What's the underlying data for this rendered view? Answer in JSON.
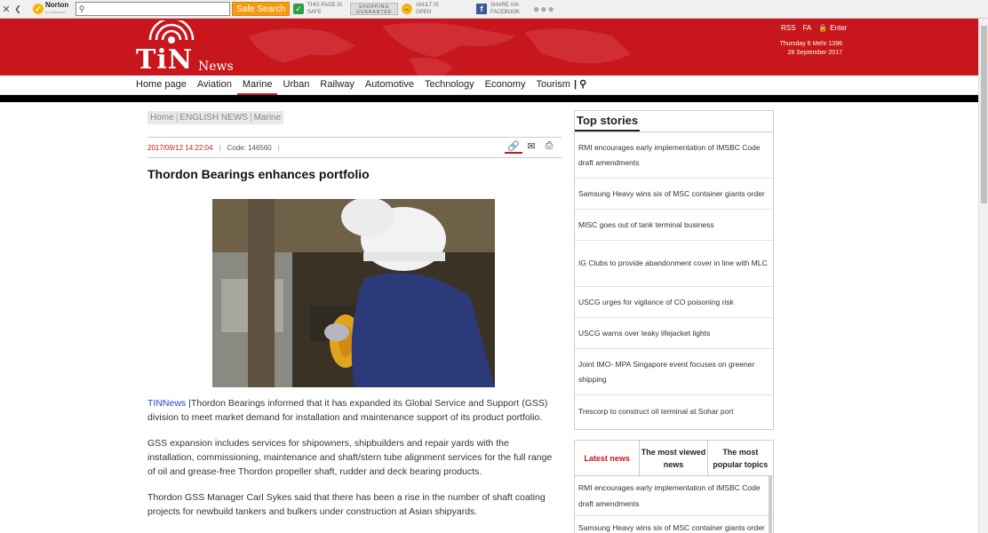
{
  "toolbar": {
    "close": "✕",
    "collapse": "❮",
    "brand": "Norton",
    "brand_sub": "by Symantec",
    "search_placeholder": "",
    "search_button": "Safe Search",
    "page_safe_line1": "THIS PAGE IS",
    "page_safe_line2": "SAFE",
    "guarantee_line1": "SHOPPING",
    "guarantee_line2": "GUARANTEE",
    "vault_line1": "VAULT IS",
    "vault_line2": "OPEN",
    "share_line1": "SHARE VIA",
    "share_line2": "FACEBOOK",
    "more": "●●●"
  },
  "header": {
    "logo_main": "TiN",
    "logo_sub": "News",
    "rss": "RSS",
    "fa": "FA",
    "enter": "Enter",
    "date_persian": "Thursday 6 Mehr 1396",
    "date_gregorian": "28 September 2017",
    "colors": {
      "brand_red": "#c8161d"
    }
  },
  "nav": {
    "items": [
      "Home page",
      "Aviation",
      "Marine",
      "Urban",
      "Railway",
      "Automotive",
      "Technology",
      "Economy",
      "Tourism"
    ],
    "active": "Marine",
    "search_icon": "search-icon"
  },
  "article": {
    "breadcrumb": [
      "Home",
      "ENGLISH NEWS",
      "Marine"
    ],
    "datetime": "2017/09/12 14:22:04",
    "code": "Code: 146560",
    "title": "Thordon Bearings enhances portfolio",
    "source": "TINNews",
    "paragraphs": [
      "|Thordon Bearings informed that it has expanded its Global Service and Support (GSS) division to meet market demand for installation and maintenance support of its product portfolio.",
      "GSS expansion includes services for shipowners, shipbuilders and repair yards with the installation, commissioning, maintenance and shaft/stern tube alignment services for the full range of oil and grease-free Thordon propeller shaft, rudder and deck bearing products.",
      "Thordon GSS Manager Carl Sykes said that there has been a rise in the number of shaft coating projects for newbuild tankers and bulkers under construction at Asian shipyards."
    ]
  },
  "sidebar": {
    "top_stories_title": "Top stories",
    "top_stories": [
      "RMI encourages early implementation of IMSBC Code draft amendments",
      "Samsung Heavy wins six of MSC container giants order",
      "MISC goes out of tank terminal business",
      "IG Clubs to provide abandonment cover in line with MLC",
      "USCG urges for vigilance of CO poisoning risk",
      "USCG warns over leaky lifejacket lights",
      "Joint IMO- MPA Singapore event focuses on greener shipping",
      "Trescorp to construct oil terminal at Sohar port"
    ],
    "tabs": [
      "Latest news",
      "The most viewed news",
      "The most popular topics"
    ],
    "latest": [
      "RMI encourages early implementation of IMSBC Code draft amendments",
      "Samsung Heavy wins six of MSC container giants order"
    ]
  }
}
